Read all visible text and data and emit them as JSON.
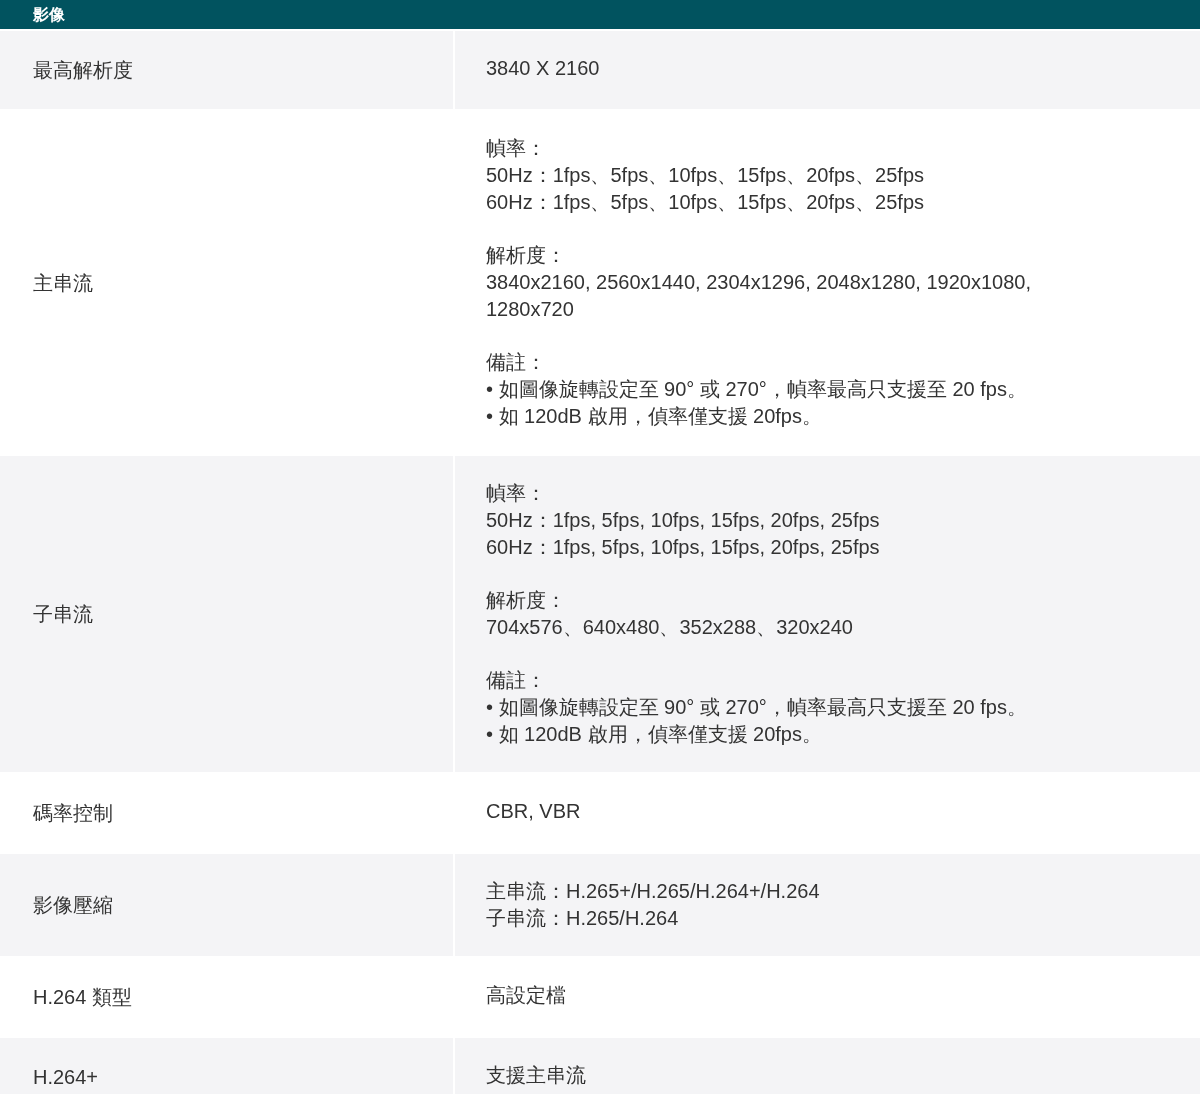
{
  "section_header": "影像",
  "rows": [
    {
      "label": "最高解析度",
      "blocks": [
        [
          "3840 X 2160"
        ]
      ]
    },
    {
      "label": "主串流",
      "blocks": [
        [
          "幀率：",
          "50Hz：1fps、5fps、10fps、15fps、20fps、25fps",
          "60Hz：1fps、5fps、10fps、15fps、20fps、25fps"
        ],
        [
          "解析度：",
          "3840x2160, 2560x1440, 2304x1296, 2048x1280, 1920x1080,",
          "1280x720"
        ],
        [
          "備註：",
          "• 如圖像旋轉設定至 90° 或 270°，幀率最高只支援至 20 fps。",
          "• 如 120dB 啟用，偵率僅支援 20fps。"
        ]
      ]
    },
    {
      "label": "子串流",
      "blocks": [
        [
          "幀率：",
          "50Hz：1fps, 5fps, 10fps, 15fps, 20fps, 25fps",
          "60Hz：1fps, 5fps, 10fps, 15fps, 20fps, 25fps"
        ],
        [
          "解析度：",
          "704x576、640x480、352x288、320x240"
        ],
        [
          "備註：",
          "• 如圖像旋轉設定至 90° 或 270°，幀率最高只支援至 20 fps。",
          "• 如 120dB 啟用，偵率僅支援 20fps。"
        ]
      ]
    },
    {
      "label": "碼率控制",
      "blocks": [
        [
          "CBR, VBR"
        ]
      ]
    },
    {
      "label": "影像壓縮",
      "blocks": [
        [
          "主串流：H.265+/H.265/H.264+/H.264",
          "子串流：H.265/H.264"
        ]
      ]
    },
    {
      "label": "H.264 類型",
      "blocks": [
        [
          "高設定檔"
        ]
      ]
    },
    {
      "label": "H.264+",
      "blocks": [
        [
          "支援主串流"
        ]
      ]
    }
  ]
}
